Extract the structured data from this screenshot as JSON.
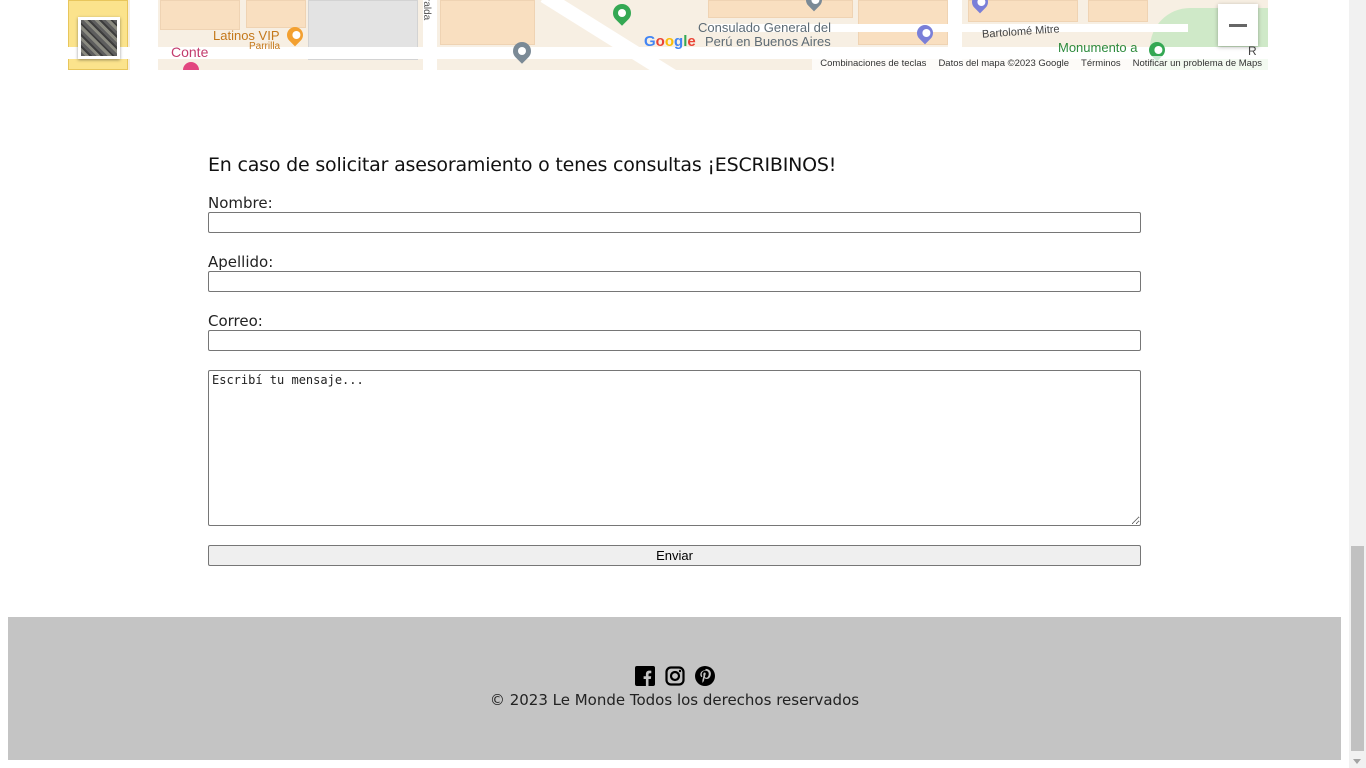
{
  "map": {
    "labels": {
      "conte": "Conte",
      "latinos_vip": "Latinos VIP",
      "parrilla": "Parrilla",
      "street_vertical": "ralda",
      "consulado_1": "Consulado General del",
      "consulado_2": "Perú en Buenos Aires",
      "bartolome_mitre": "Bartolomé Mitre",
      "monumento": "Monumento a",
      "corner_fragment": "R"
    },
    "google_logo": "Google",
    "attribution": {
      "shortcuts": "Combinaciones de teclas",
      "data": "Datos del mapa ©2023 Google",
      "terms": "Términos",
      "report": "Notificar un problema de Maps"
    },
    "controls": {
      "zoom_out_icon": "minus-icon",
      "layer_toggle_icon": "satellite-thumbnail"
    },
    "colors": {
      "pin_green": "#34a853",
      "pin_gray": "#7b8a96",
      "pin_orange": "#f3a030",
      "pin_purple": "#7a7fd8",
      "park_green": "#cfe9c8"
    }
  },
  "contact": {
    "title": "En caso de solicitar asesoramiento o tenes consultas ¡ESCRIBINOS!",
    "fields": [
      {
        "label": "Nombre:",
        "value": ""
      },
      {
        "label": "Apellido:",
        "value": ""
      },
      {
        "label": "Correo:",
        "value": ""
      }
    ],
    "message_placeholder": "Escribí tu mensaje...",
    "submit_label": "Enviar"
  },
  "footer": {
    "socials": [
      "facebook-icon",
      "instagram-icon",
      "pinterest-icon"
    ],
    "copyright": "© 2023 Le Monde Todos los derechos reservados",
    "background": "#c4c4c4"
  }
}
